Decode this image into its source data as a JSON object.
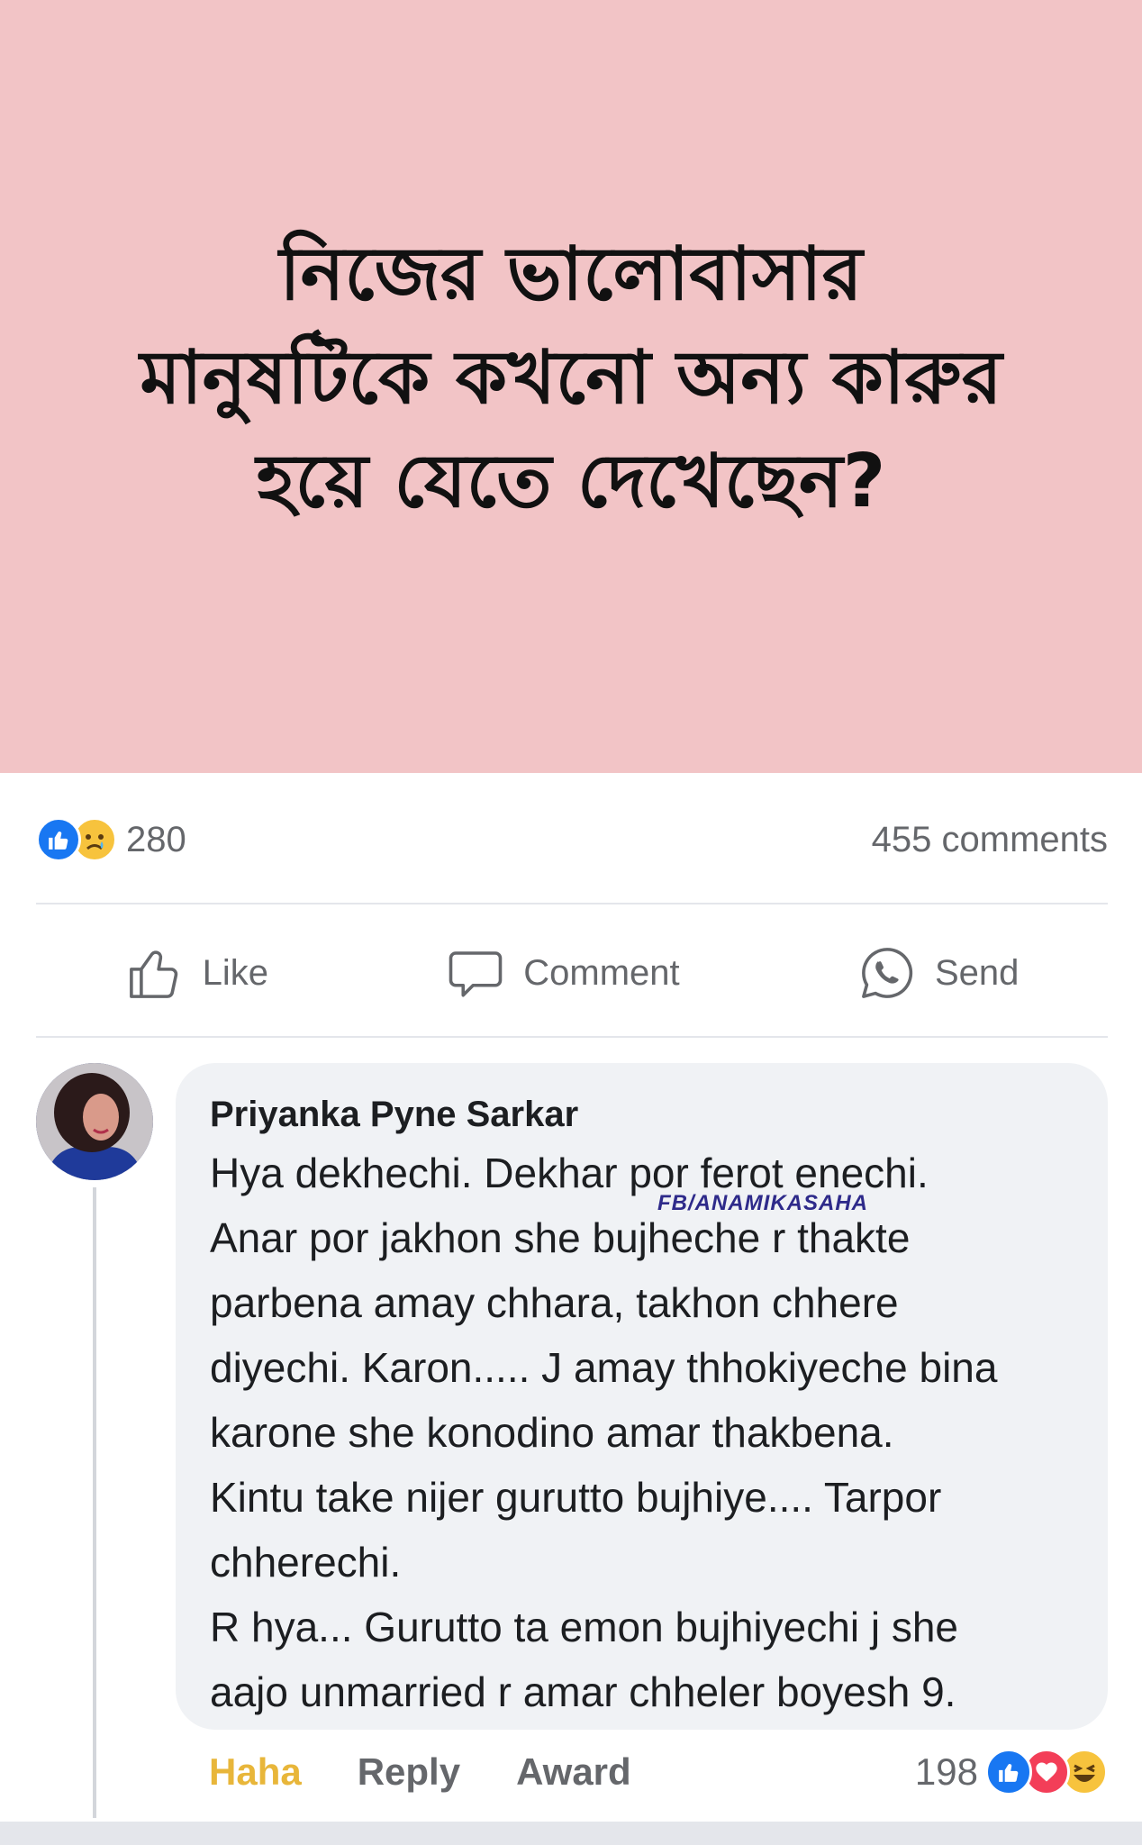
{
  "post": {
    "image_text": "নিজের ভালোবাসার মানুষটিকে কখনো অন্য কারুর হয়ে যেতে দেখেছেন?",
    "background_color": "#f2c4c6"
  },
  "stats": {
    "reaction_icons": [
      "like-icon",
      "sad-icon"
    ],
    "reaction_count": "280",
    "comments_count": "455 comments"
  },
  "actions": {
    "like_label": "Like",
    "comment_label": "Comment",
    "send_label": "Send"
  },
  "comment": {
    "author": "Priyanka Pyne Sarkar",
    "text": "Hya dekhechi. Dekhar por ferot enechi.\nAnar por jakhon she bujheche r thakte\nparbena amay chhara, takhon chhere\ndiyechi. Karon..... J amay thhokiyeche bina\nkarone she konodino amar thakbena.\nKintu take nijer gurutto bujhiye.... Tarpor\nchherechi.\nR hya... Gurutto ta emon bujhiyechi j she\naajo unmarried r amar chheler boyesh 9.",
    "watermark": "FB/ANAMIKASAHA",
    "actions": {
      "haha_label": "Haha",
      "reply_label": "Reply",
      "award_label": "Award"
    },
    "reaction_count": "198",
    "reaction_icons": [
      "like-icon",
      "love-icon",
      "haha-icon"
    ]
  },
  "colors": {
    "accent_blue": "#1877f2",
    "haha_yellow": "#e8b63a",
    "secondary_text": "#65676b"
  }
}
